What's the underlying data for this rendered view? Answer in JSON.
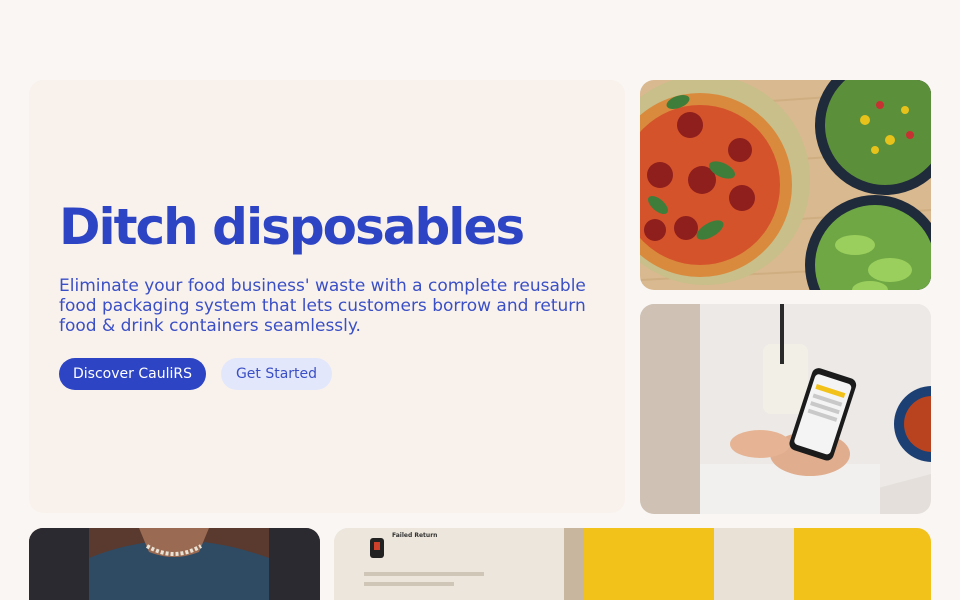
{
  "hero": {
    "title": "Ditch disposables",
    "description": "Eliminate your food business' waste with a complete reusable food packaging system that lets customers borrow and return food & drink containers seamlessly.",
    "primary_button": "Discover CauliRS",
    "secondary_button": "Get Started"
  },
  "app_tile": {
    "card_heading": "Failed Return"
  },
  "colors": {
    "brand_blue": "#2d44c4",
    "secondary_button_bg": "#e3e7fb",
    "page_bg": "#faf6f3",
    "hero_bg": "#f9f2ec",
    "accent_yellow": "#f2c21b"
  }
}
